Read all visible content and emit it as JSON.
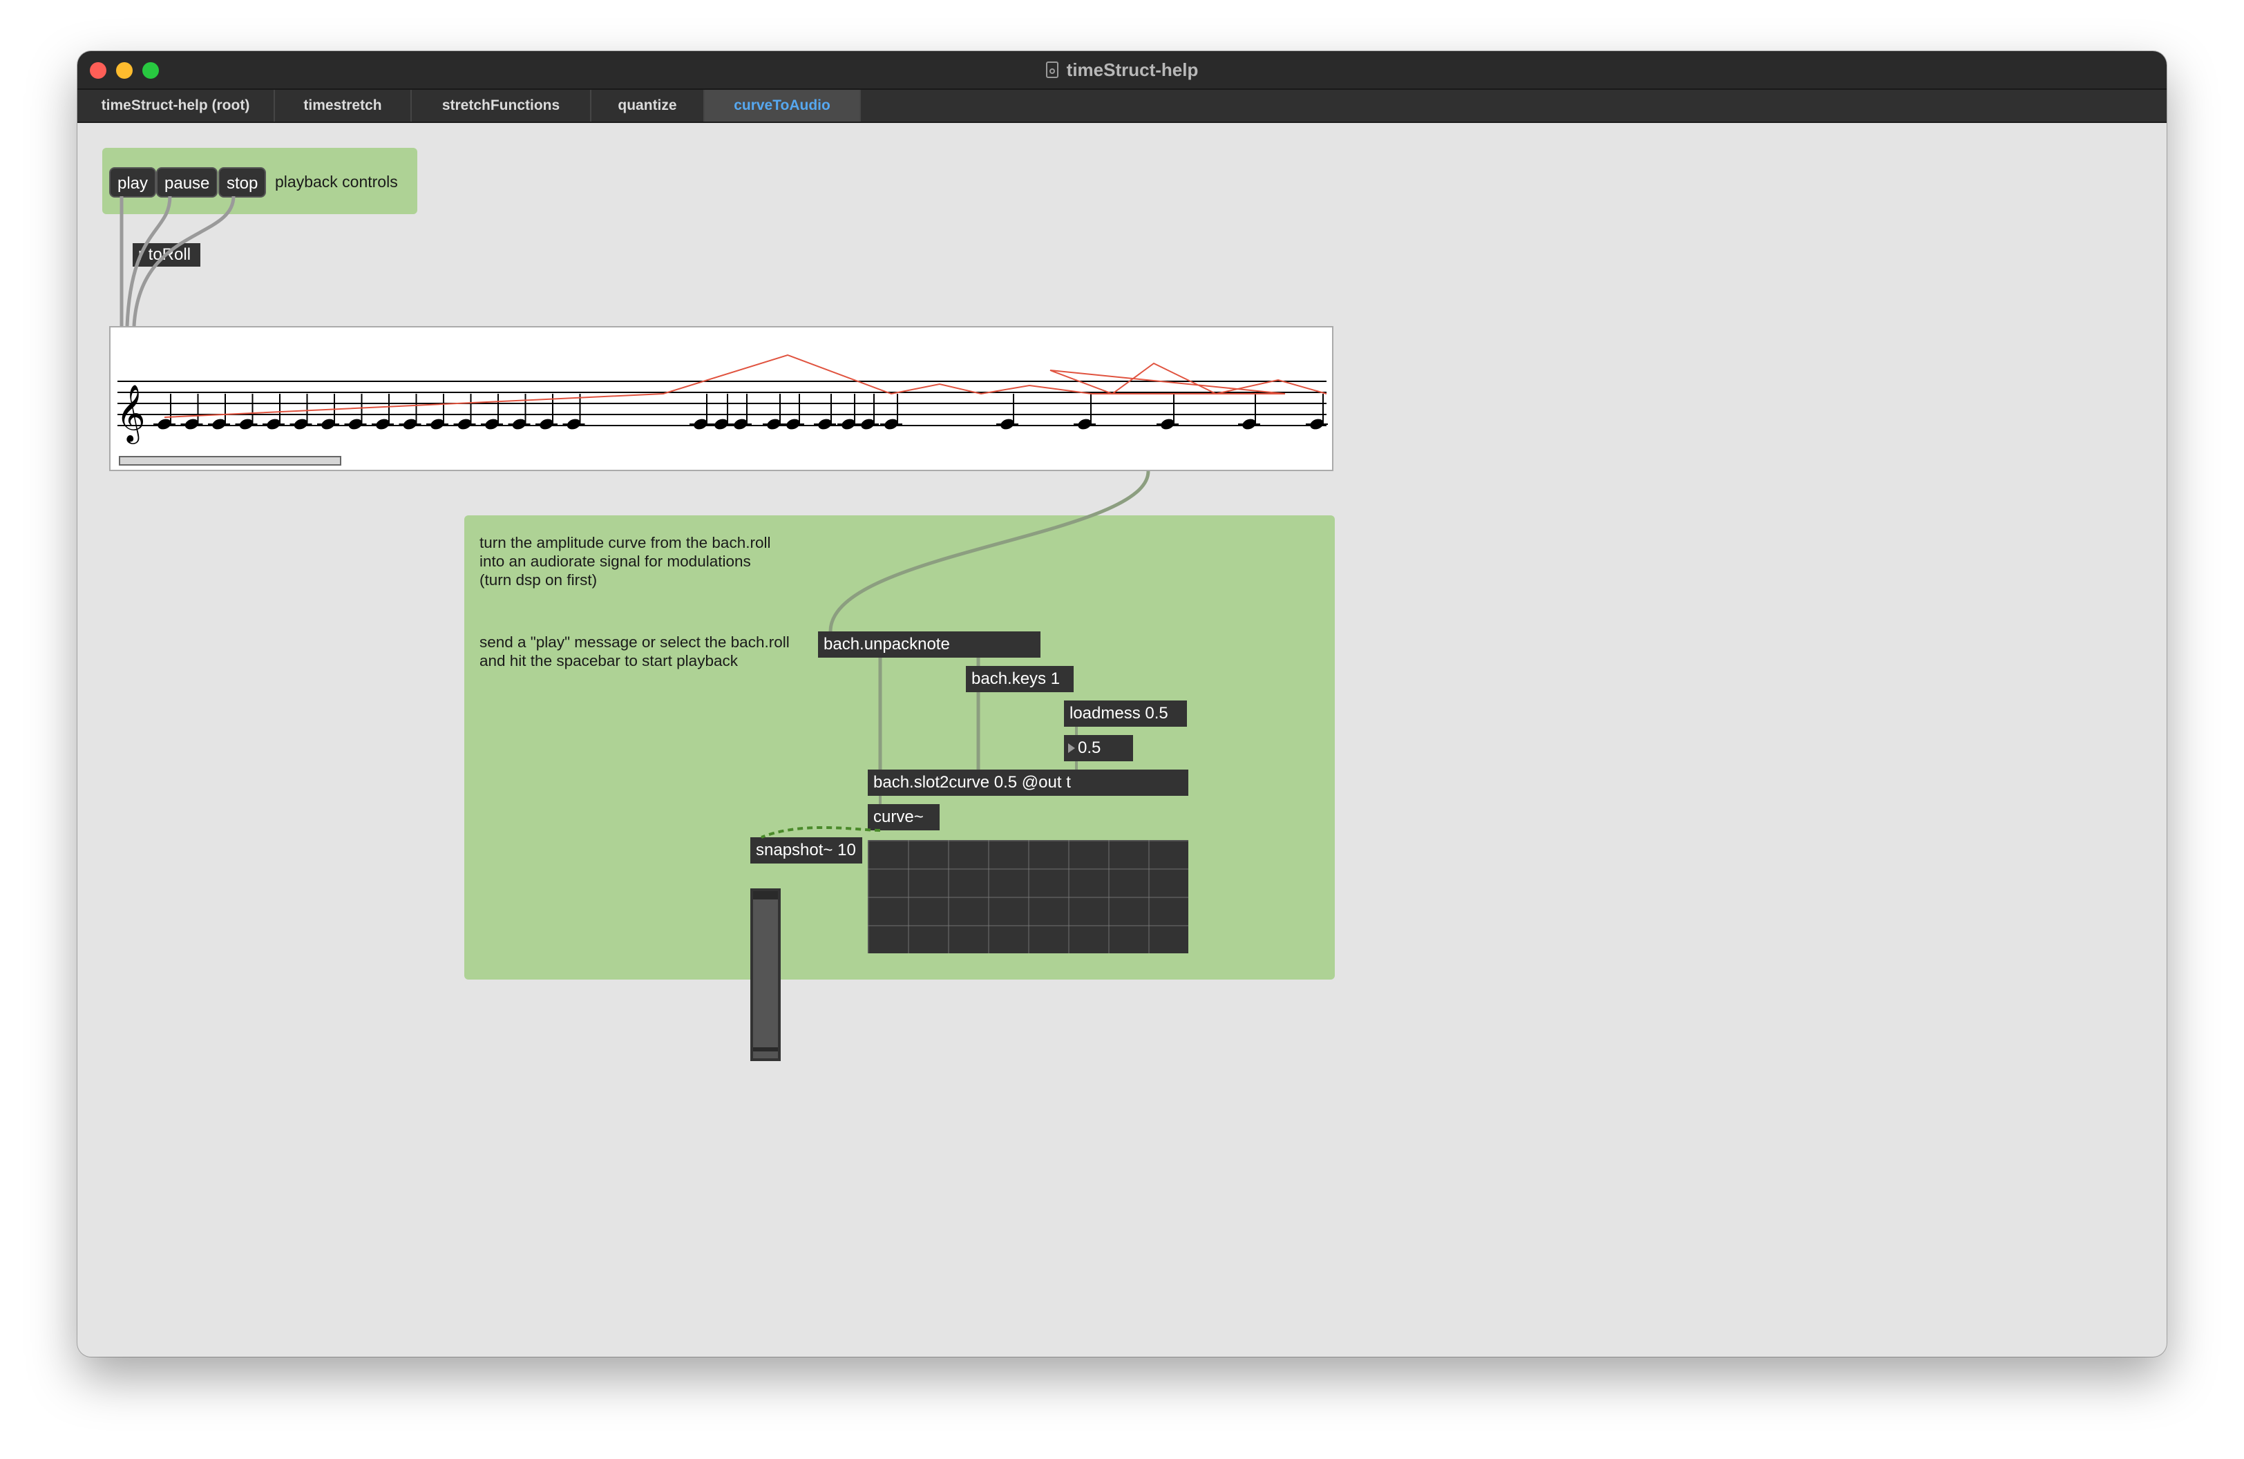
{
  "window": {
    "title": "timeStruct-help"
  },
  "tabs": [
    {
      "label": "timeStruct-help (root)",
      "active": false
    },
    {
      "label": "timestretch",
      "active": false
    },
    {
      "label": "stretchFunctions",
      "active": false
    },
    {
      "label": "quantize",
      "active": false
    },
    {
      "label": "curveToAudio",
      "active": true
    }
  ],
  "playback": {
    "play_label": "play",
    "pause_label": "pause",
    "stop_label": "stop",
    "comment": "playback controls"
  },
  "objects": {
    "receive": "r toRoll",
    "unpacknote": "bach.unpacknote",
    "keys": "bach.keys 1",
    "loadmess": "loadmess 0.5",
    "number_value": "0.5",
    "slot2curve": "bach.slot2curve 0.5 @out t",
    "curve": "curve~",
    "snapshot": "snapshot~ 10"
  },
  "comments": {
    "intro": "turn the amplitude curve from the bach.roll\ninto an audiorate signal for modulations\n(turn dsp on first)",
    "instructions": "send a \"play\" message or select the bach.roll\nand hit the spacebar to start playback"
  },
  "colors": {
    "panel_green": "#a9d08e",
    "object_bg": "#333333",
    "active_tab": "#56a8f0",
    "curve_red": "#e0533f"
  },
  "icons": {
    "document": "doc-icon",
    "clef": "treble-clef-icon"
  }
}
